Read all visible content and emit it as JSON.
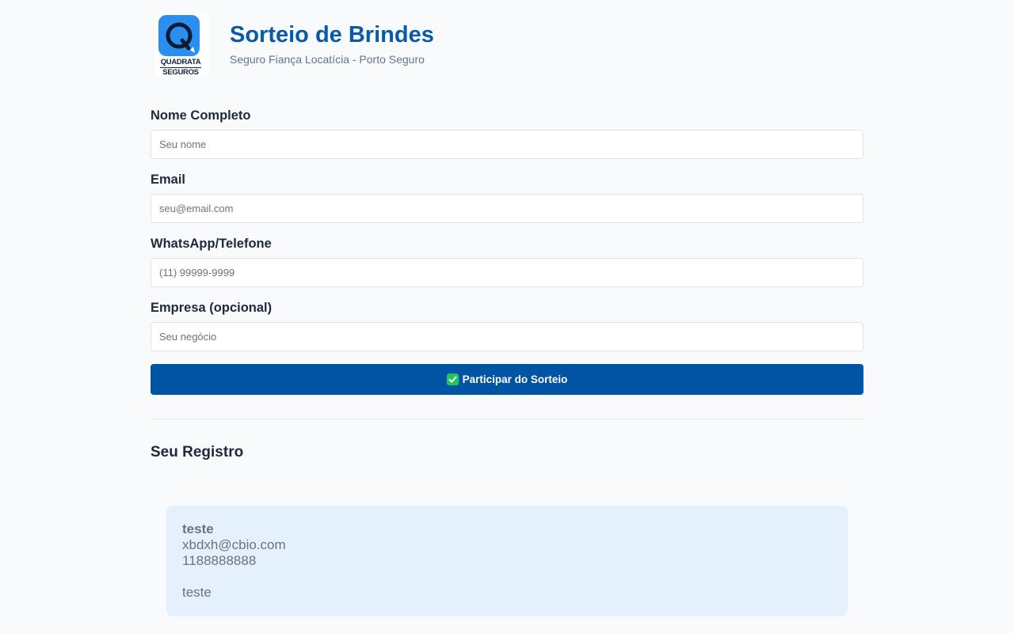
{
  "header": {
    "logo_line1": "QUADRATA",
    "logo_line2": "SEGUROS",
    "title": "Sorteio de Brindes",
    "subtitle": "Seguro Fiança Locatícia - Porto Seguro"
  },
  "form": {
    "name": {
      "label": "Nome Completo",
      "placeholder": "Seu nome",
      "value": ""
    },
    "email": {
      "label": "Email",
      "placeholder": "seu@email.com",
      "value": ""
    },
    "phone": {
      "label": "WhatsApp/Telefone",
      "placeholder": "(11) 99999-9999",
      "value": ""
    },
    "company": {
      "label": "Empresa (opcional)",
      "placeholder": "Seu negócio",
      "value": ""
    },
    "submit_label": "Participar do Sorteio"
  },
  "registration": {
    "title": "Seu Registro",
    "name": "teste",
    "email": "xbdxh@cbio.com",
    "phone": "1188888888",
    "company": "teste"
  },
  "colors": {
    "brand": "#0054a3",
    "title": "#0b5aa6",
    "card_bg": "#e5f0fd",
    "logo_badge": "#2b8ff0"
  }
}
